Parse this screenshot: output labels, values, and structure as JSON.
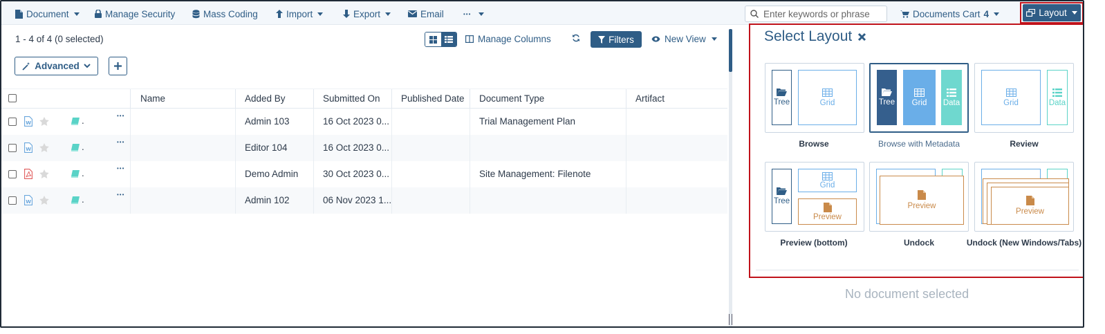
{
  "toolbar": {
    "document": "Document",
    "manage_security": "Manage Security",
    "mass_coding": "Mass Coding",
    "import": "Import",
    "export": "Export",
    "email": "Email",
    "more": "•••",
    "search_placeholder": "Enter keywords or phrase",
    "cart_label": "Documents Cart",
    "cart_count": "4",
    "layout": "Layout"
  },
  "list": {
    "count": "1 - 4 of 4 (0 selected)",
    "manage_columns": "Manage Columns",
    "filters": "Filters",
    "new_view": "New View",
    "advanced": "Advanced"
  },
  "table": {
    "columns": [
      "Name",
      "Added By",
      "Submitted On",
      "Published Date",
      "Document Type",
      "Artifact"
    ],
    "rows": [
      {
        "file_type": "word",
        "added_by": "Admin 103",
        "submitted_on": "16 Oct 2023 0...",
        "published_date": "",
        "document_type": "Trial Management Plan",
        "artifact": ""
      },
      {
        "file_type": "word",
        "added_by": "Editor 104",
        "submitted_on": "16 Oct 2023 0...",
        "published_date": "",
        "document_type": "",
        "artifact": ""
      },
      {
        "file_type": "pdf",
        "added_by": "Demo Admin",
        "submitted_on": "30 Oct 2023 0...",
        "published_date": "",
        "document_type": "Site Management: Filenote",
        "artifact": ""
      },
      {
        "file_type": "word",
        "added_by": "Admin 102",
        "submitted_on": "06 Nov 2023 1...",
        "published_date": "",
        "document_type": "",
        "artifact": ""
      }
    ]
  },
  "layout_panel": {
    "title": "Select Layout",
    "pane_labels": {
      "tree": "Tree",
      "grid": "Grid",
      "data": "Data",
      "preview": "Preview"
    },
    "options": [
      {
        "label": "Browse",
        "selected": false
      },
      {
        "label": "Browse with Metadata",
        "selected": true
      },
      {
        "label": "Review",
        "selected": false
      },
      {
        "label": "Preview (bottom)",
        "selected": false
      },
      {
        "label": "Undock",
        "selected": false
      },
      {
        "label": "Undock (New Windows/Tabs)",
        "selected": false
      }
    ]
  },
  "preview_area": {
    "empty_text": "No document selected"
  },
  "colors": {
    "accent": "#2f5d86",
    "grid": "#6aaee8",
    "data": "#5ad3c7",
    "preview": "#c98a4a",
    "highlight": "#c0121a"
  },
  "icons": [
    "document-icon",
    "lock-icon",
    "database-icon",
    "arrow-up-icon",
    "arrow-down-icon",
    "envelope-icon",
    "search-icon",
    "cart-icon",
    "layout-icon",
    "columns-icon",
    "refresh-icon",
    "filter-icon",
    "eye-icon",
    "magic-wand-icon",
    "plus-icon",
    "word-file-icon",
    "pdf-file-icon",
    "star-icon",
    "book-icon",
    "ellipsis-icon",
    "close-icon",
    "folder-icon",
    "table-icon",
    "list-icon",
    "page-icon"
  ]
}
